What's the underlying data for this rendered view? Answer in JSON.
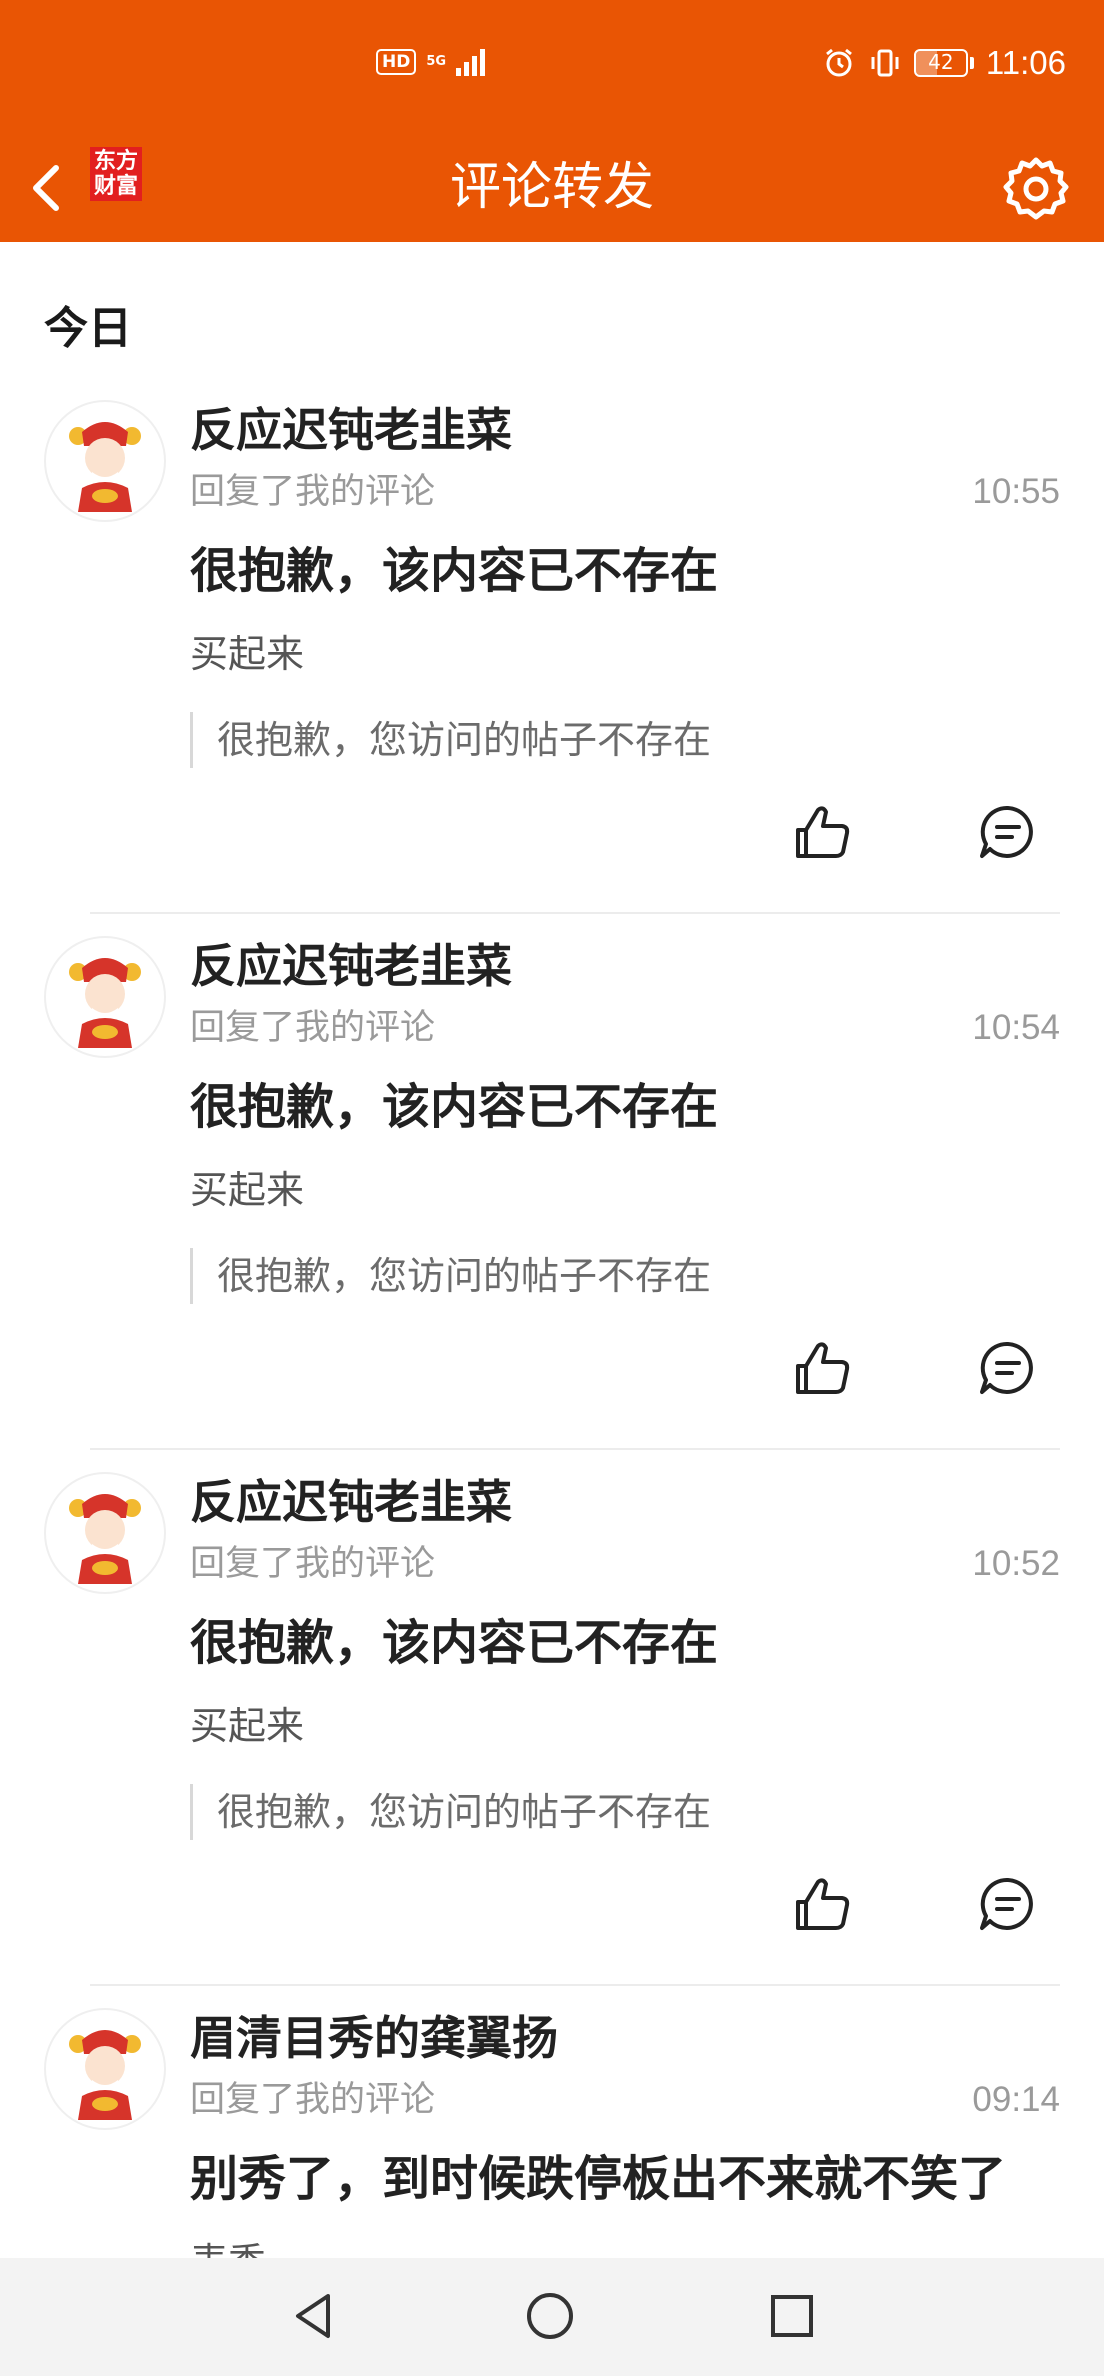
{
  "status_bar": {
    "hd_label": "HD",
    "network_label": "5G",
    "battery_level": "42",
    "time": "11:06"
  },
  "header": {
    "logo_line1": "东方",
    "logo_line2": "财富",
    "title": "评论转发",
    "back_icon": "chevron-left-icon",
    "settings_icon": "gear-icon"
  },
  "section": {
    "title": "今日"
  },
  "items": [
    {
      "username": "反应迟钝老韭菜",
      "action": "回复了我的评论",
      "time": "10:55",
      "main_text": "很抱歉，该内容已不存在",
      "reply": "买起来",
      "quote": "很抱歉，您访问的帖子不存在"
    },
    {
      "username": "反应迟钝老韭菜",
      "action": "回复了我的评论",
      "time": "10:54",
      "main_text": "很抱歉，该内容已不存在",
      "reply": "买起来",
      "quote": "很抱歉，您访问的帖子不存在"
    },
    {
      "username": "反应迟钝老韭菜",
      "action": "回复了我的评论",
      "time": "10:52",
      "main_text": "很抱歉，该内容已不存在",
      "reply": "买起来",
      "quote": "很抱歉，您访问的帖子不存在"
    },
    {
      "username": "眉清目秀的龚翼扬",
      "action": "回复了我的评论",
      "time": "09:14",
      "main_text": "别秀了，到时候跌停板出不来就不笑了",
      "reply": "表秀",
      "quote": ""
    }
  ],
  "colors": {
    "accent": "#E95504",
    "logo_red": "#E21F1F",
    "secondary_text": "#9a9a9a"
  }
}
